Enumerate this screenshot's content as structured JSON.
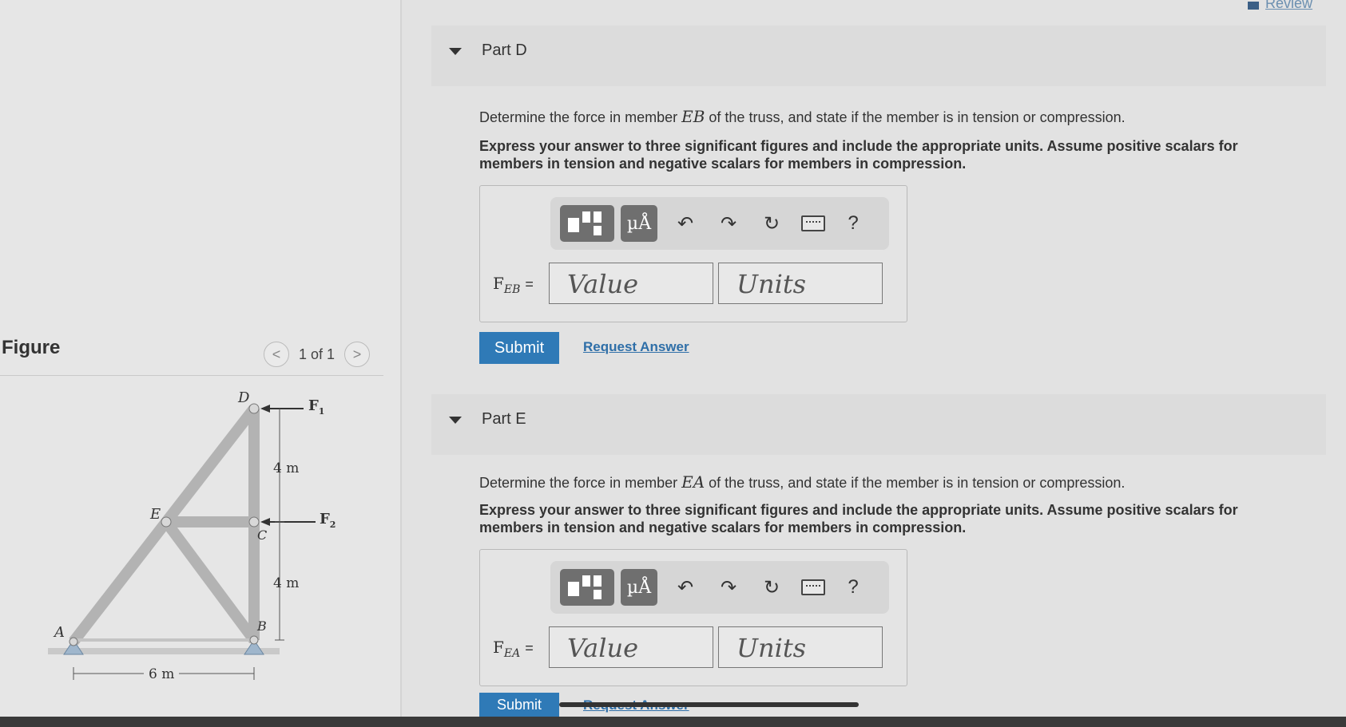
{
  "header": {
    "review_label": "Review"
  },
  "figure": {
    "title": "Figure",
    "pager_text": "1 of 1",
    "prev_glyph": "<",
    "next_glyph": ">",
    "labels": {
      "D": "D",
      "E": "E",
      "C": "C",
      "A": "A",
      "B": "B",
      "F1": "F",
      "F1_sub": "1",
      "F2": "F",
      "F2_sub": "2",
      "dim_top": "4 m",
      "dim_bottom": "4 m",
      "dim_base": "6 m"
    }
  },
  "toolbar": {
    "units_glyph": "µÅ",
    "undo_glyph": "↶",
    "redo_glyph": "↷",
    "reset_glyph": "↻",
    "help_glyph": "?"
  },
  "parts": [
    {
      "title": "Part D",
      "question_pre": "Determine the force in member ",
      "member": "EB",
      "question_post": " of the truss, and state if the member is in tension or compression.",
      "instructions": "Express your answer to three significant figures and include the appropriate units. Assume positive scalars for members in tension and negative scalars for members in compression.",
      "var_main": "F",
      "var_sub": "EB",
      "equals": "=",
      "value_placeholder": "Value",
      "units_placeholder": "Units",
      "submit_label": "Submit",
      "request_label": "Request Answer"
    },
    {
      "title": "Part E",
      "question_pre": "Determine the force in member ",
      "member": "EA",
      "question_post": " of the truss, and state if the member is in tension or compression.",
      "instructions": "Express your answer to three significant figures and include the appropriate units. Assume positive scalars for members in tension and negative scalars for members in compression.",
      "var_main": "F",
      "var_sub": "EA",
      "equals": "=",
      "value_placeholder": "Value",
      "units_placeholder": "Units",
      "submit_label": "Submit",
      "request_label": "Request Answer"
    }
  ]
}
